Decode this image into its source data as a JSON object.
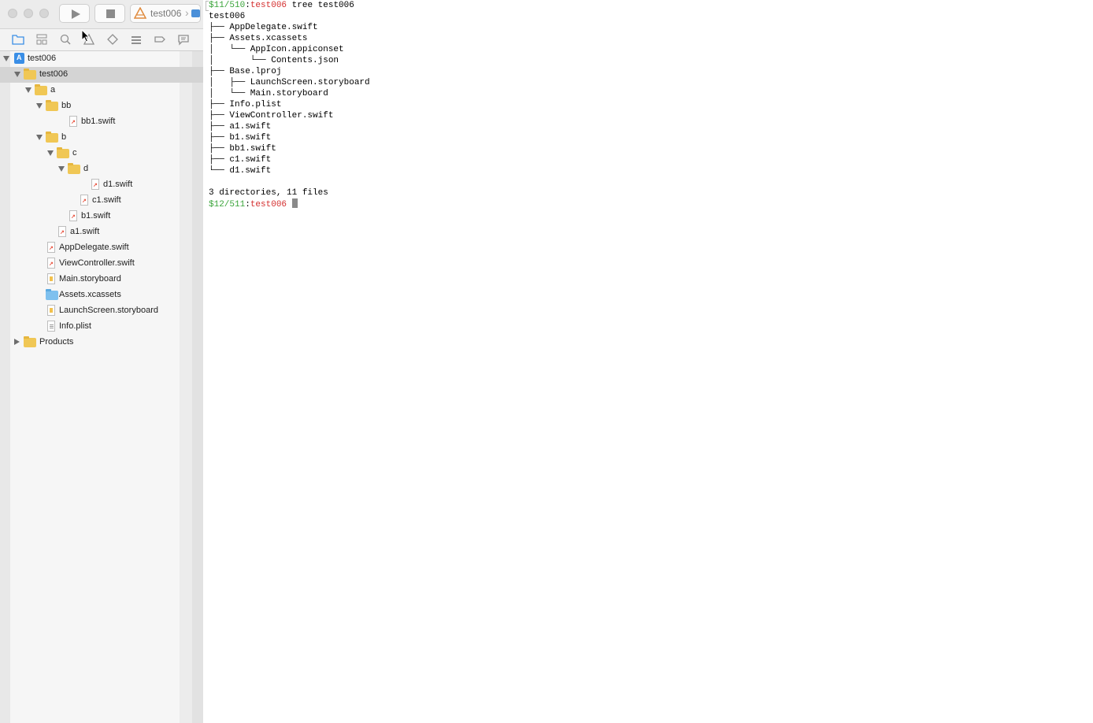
{
  "xcode": {
    "scheme_label": "test006",
    "tree": [
      {
        "label": "test006",
        "kind": "project",
        "depth": 0,
        "disclosure": "open",
        "selected": false
      },
      {
        "label": "test006",
        "kind": "folder",
        "depth": 1,
        "disclosure": "open",
        "selected": true
      },
      {
        "label": "a",
        "kind": "folder",
        "depth": 2,
        "disclosure": "open",
        "selected": false
      },
      {
        "label": "bb",
        "kind": "folder",
        "depth": 3,
        "disclosure": "open",
        "selected": false
      },
      {
        "label": "bb1.swift",
        "kind": "swift",
        "depth": 4,
        "disclosure": "none",
        "selected": false
      },
      {
        "label": "b",
        "kind": "folder",
        "depth": 3,
        "disclosure": "open",
        "selected": false
      },
      {
        "label": "c",
        "kind": "folder",
        "depth": 4,
        "disclosure": "open",
        "selected": false
      },
      {
        "label": "d",
        "kind": "folder",
        "depth": 5,
        "disclosure": "open",
        "selected": false
      },
      {
        "label": "d1.swift",
        "kind": "swift",
        "depth": 6,
        "disclosure": "none",
        "selected": false
      },
      {
        "label": "c1.swift",
        "kind": "swift",
        "depth": 5,
        "disclosure": "none",
        "selected": false
      },
      {
        "label": "b1.swift",
        "kind": "swift",
        "depth": 4,
        "disclosure": "none",
        "selected": false
      },
      {
        "label": "a1.swift",
        "kind": "swift",
        "depth": 3,
        "disclosure": "none",
        "selected": false
      },
      {
        "label": "AppDelegate.swift",
        "kind": "swift",
        "depth": 2,
        "disclosure": "none",
        "selected": false
      },
      {
        "label": "ViewController.swift",
        "kind": "swift",
        "depth": 2,
        "disclosure": "none",
        "selected": false
      },
      {
        "label": "Main.storyboard",
        "kind": "storyboard",
        "depth": 2,
        "disclosure": "none",
        "selected": false
      },
      {
        "label": "Assets.xcassets",
        "kind": "assets",
        "depth": 2,
        "disclosure": "none",
        "selected": false
      },
      {
        "label": "LaunchScreen.storyboard",
        "kind": "storyboard",
        "depth": 2,
        "disclosure": "none",
        "selected": false
      },
      {
        "label": "Info.plist",
        "kind": "plist",
        "depth": 2,
        "disclosure": "none",
        "selected": false
      },
      {
        "label": "Products",
        "kind": "folder",
        "depth": 1,
        "disclosure": "closed",
        "selected": false
      }
    ],
    "icons": {
      "play": "play-icon",
      "stop": "stop-icon",
      "navigator": [
        "project-navigator-icon",
        "source-control-icon",
        "find-icon",
        "issue-icon",
        "test-icon",
        "debug-icon",
        "breakpoint-icon",
        "report-icon"
      ]
    }
  },
  "terminal": {
    "prompt1": {
      "counter": "$11/510",
      "sep": ":",
      "dir": "test006",
      "command": " tree test006"
    },
    "output": [
      "test006",
      "├── AppDelegate.swift",
      "├── Assets.xcassets",
      "│   └── AppIcon.appiconset",
      "│       └── Contents.json",
      "├── Base.lproj",
      "│   ├── LaunchScreen.storyboard",
      "│   └── Main.storyboard",
      "├── Info.plist",
      "├── ViewController.swift",
      "├── a1.swift",
      "├── b1.swift",
      "├── bb1.swift",
      "├── c1.swift",
      "└── d1.swift",
      "",
      "3 directories, 11 files"
    ],
    "prompt2": {
      "counter": "$12/511",
      "sep": ":",
      "dir": "test006",
      "command": " "
    }
  },
  "colors": {
    "prompt_counter": "#3aa43a",
    "prompt_dir": "#d42f2f",
    "selection": "#d4d4d4",
    "folder": "#f0c755"
  }
}
